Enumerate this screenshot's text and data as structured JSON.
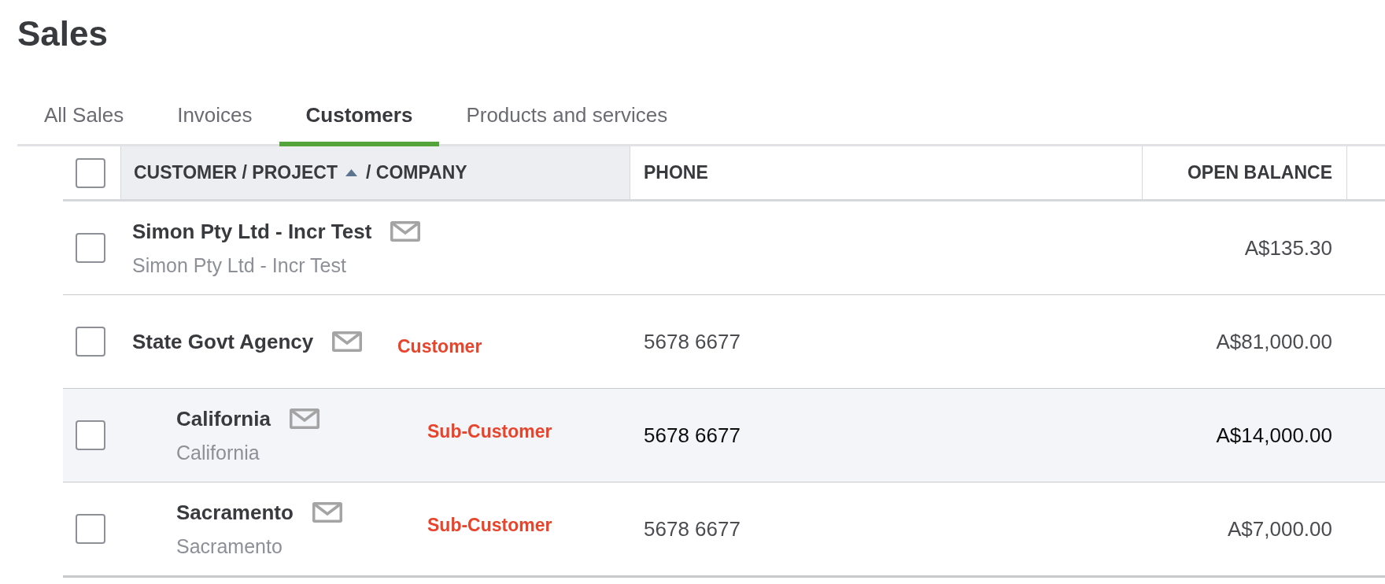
{
  "page": {
    "title": "Sales"
  },
  "tabs": [
    {
      "label": "All Sales",
      "selected": false
    },
    {
      "label": "Invoices",
      "selected": false
    },
    {
      "label": "Customers",
      "selected": true
    },
    {
      "label": "Products and services",
      "selected": false
    }
  ],
  "table": {
    "select_all": {
      "checked": false
    },
    "columns": [
      {
        "kind": "name",
        "label": "CUSTOMER / PROJECT",
        "sorted": true,
        "ascending": true,
        "secondary_label": "/ COMPANY"
      },
      {
        "kind": "phone",
        "label": "PHONE"
      },
      {
        "kind": "amount",
        "label": "OPEN BALANCE"
      }
    ],
    "rows": [
      {
        "name": "Simon Pty Ltd - Incr Test",
        "company": "Simon Pty Ltd - Incr Test",
        "balance": "A$135.30",
        "checked": false,
        "highlighted": false
      },
      {
        "name": "State Govt Agency",
        "annotation": "Customer",
        "phone": "5678 6677",
        "balance": "A$81,000.00",
        "checked": false,
        "highlighted": false,
        "children": [
          {
            "name": "California",
            "company": "California",
            "annotation": "Sub-Customer",
            "phone": "5678 6677",
            "balance": "A$14,000.00",
            "checked": false,
            "highlighted": true
          },
          {
            "name": "Sacramento",
            "company": "Sacramento",
            "annotation": "Sub-Customer",
            "phone": "5678 6677",
            "balance": "A$7,000.00",
            "checked": false,
            "highlighted": false
          }
        ]
      }
    ]
  }
}
